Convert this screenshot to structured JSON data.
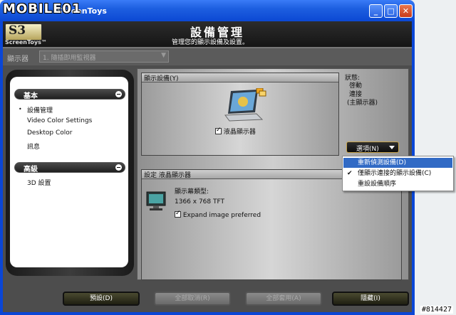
{
  "window": {
    "title": "ScreenToys",
    "watermark": "MOBILE01",
    "stamp": "#814427"
  },
  "header": {
    "logo_text": "S3",
    "logo_sub": "ScreenToys™",
    "title": "設備管理",
    "subtitle": "管理您的顯示設備及設置。"
  },
  "device_row": {
    "label": "顯示器",
    "selected": "1. 隨插即用監視器"
  },
  "nav": {
    "sections": [
      {
        "label": "基本",
        "items": [
          "設備管理",
          "Video Color Settings",
          "Desktop Color",
          "訊息"
        ]
      },
      {
        "label": "高級",
        "items": [
          "3D 設置"
        ]
      }
    ]
  },
  "display_panel": {
    "title": "顯示設備(Y)",
    "device_label": "液晶顯示器"
  },
  "status": {
    "label": "狀態:",
    "lines": [
      "啓動",
      "連接",
      "(主顯示器)"
    ]
  },
  "options_button": "選項(N)",
  "menu": {
    "items": [
      {
        "label": "重新偵測設備(D)",
        "checked": false,
        "selected": true
      },
      {
        "label": "僅顯示連接的顯示設備(C)",
        "checked": true,
        "selected": false
      },
      {
        "label": "重設設備順序",
        "checked": false,
        "selected": false
      }
    ]
  },
  "settings_panel": {
    "title": "設定 液晶顯示器",
    "type_label": "顯示幕類型:",
    "resolution": "1366 x 768 TFT",
    "expand_label": "Expand image preferred"
  },
  "buttons": {
    "default": "預設(D)",
    "reset_all": "全部取消(R)",
    "apply_all": "全部套用(A)",
    "hide": "隱藏(I)"
  }
}
